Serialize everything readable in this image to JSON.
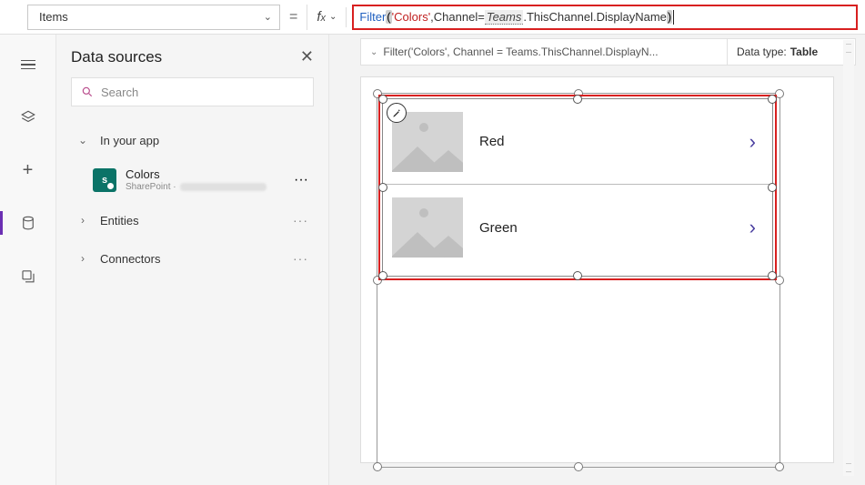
{
  "property": {
    "name": "Items"
  },
  "formula": {
    "fn": "Filter",
    "arg_str": "'Colors'",
    "field": "Channel",
    "op": "=",
    "ns": "Teams",
    "path": ".ThisChannel.DisplayName"
  },
  "breadcrumb": "Filter('Colors', Channel = Teams.ThisChannel.DisplayN...",
  "datatype": {
    "label": "Data type:",
    "value": "Table"
  },
  "panel": {
    "title": "Data sources",
    "search_placeholder": "Search",
    "sections": {
      "in_app": "In your app",
      "entities": "Entities",
      "connectors": "Connectors"
    },
    "datasource": {
      "name": "Colors",
      "subtype": "SharePoint ·"
    }
  },
  "gallery": {
    "items": [
      {
        "title": "Red"
      },
      {
        "title": "Green"
      }
    ]
  }
}
